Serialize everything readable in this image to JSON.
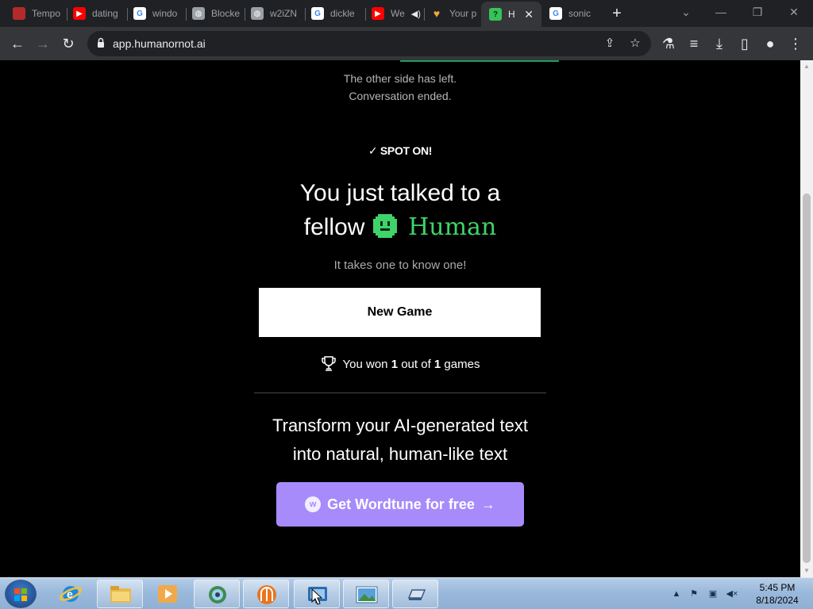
{
  "browser": {
    "tabs": [
      {
        "title": "Tempo",
        "icon": "red-square-icon"
      },
      {
        "title": "dating",
        "icon": "youtube-icon"
      },
      {
        "title": "windo",
        "icon": "google-icon"
      },
      {
        "title": "Blocke",
        "icon": "globe-icon"
      },
      {
        "title": "w2iZN",
        "icon": "globe-icon"
      },
      {
        "title": "dickle",
        "icon": "google-icon"
      },
      {
        "title": "We",
        "icon": "youtube-icon"
      },
      {
        "title": "Your p",
        "icon": "heart-icon"
      },
      {
        "title": "H",
        "icon": "question-icon"
      },
      {
        "title": "sonic",
        "icon": "google-icon"
      }
    ],
    "url": "app.humanornot.ai",
    "colors": {
      "tab_bar": "#202124",
      "toolbar": "#35363a"
    }
  },
  "page": {
    "left_message": [
      "The other side has left.",
      "Conversation ended."
    ],
    "spot_on": "SPOT ON!",
    "headline_line1": "You just talked to a",
    "headline_line2_prefix": "fellow",
    "headline_human": "Human",
    "subtitle": "It takes one to know one!",
    "new_game_label": "New Game",
    "won_prefix": "You won ",
    "won_count": "1",
    "won_middle": " out of ",
    "won_total": "1",
    "won_suffix": " games",
    "promo_line1": "Transform your AI-generated text",
    "promo_line2": "into natural, human-like text",
    "wordtune_label": "Get Wordtune for free",
    "colors": {
      "human_green": "#3fd36a",
      "wordtune_purple": "#a78bfa",
      "background": "#000000"
    }
  },
  "taskbar": {
    "clock_time": "5:45 PM",
    "clock_date": "8/18/2024",
    "apps": [
      "internet-explorer-icon",
      "file-explorer-icon",
      "media-player-icon",
      "network-globe-icon",
      "orange-app-icon",
      "remote-desktop-icon",
      "photo-viewer-icon",
      "drive-icon"
    ]
  }
}
